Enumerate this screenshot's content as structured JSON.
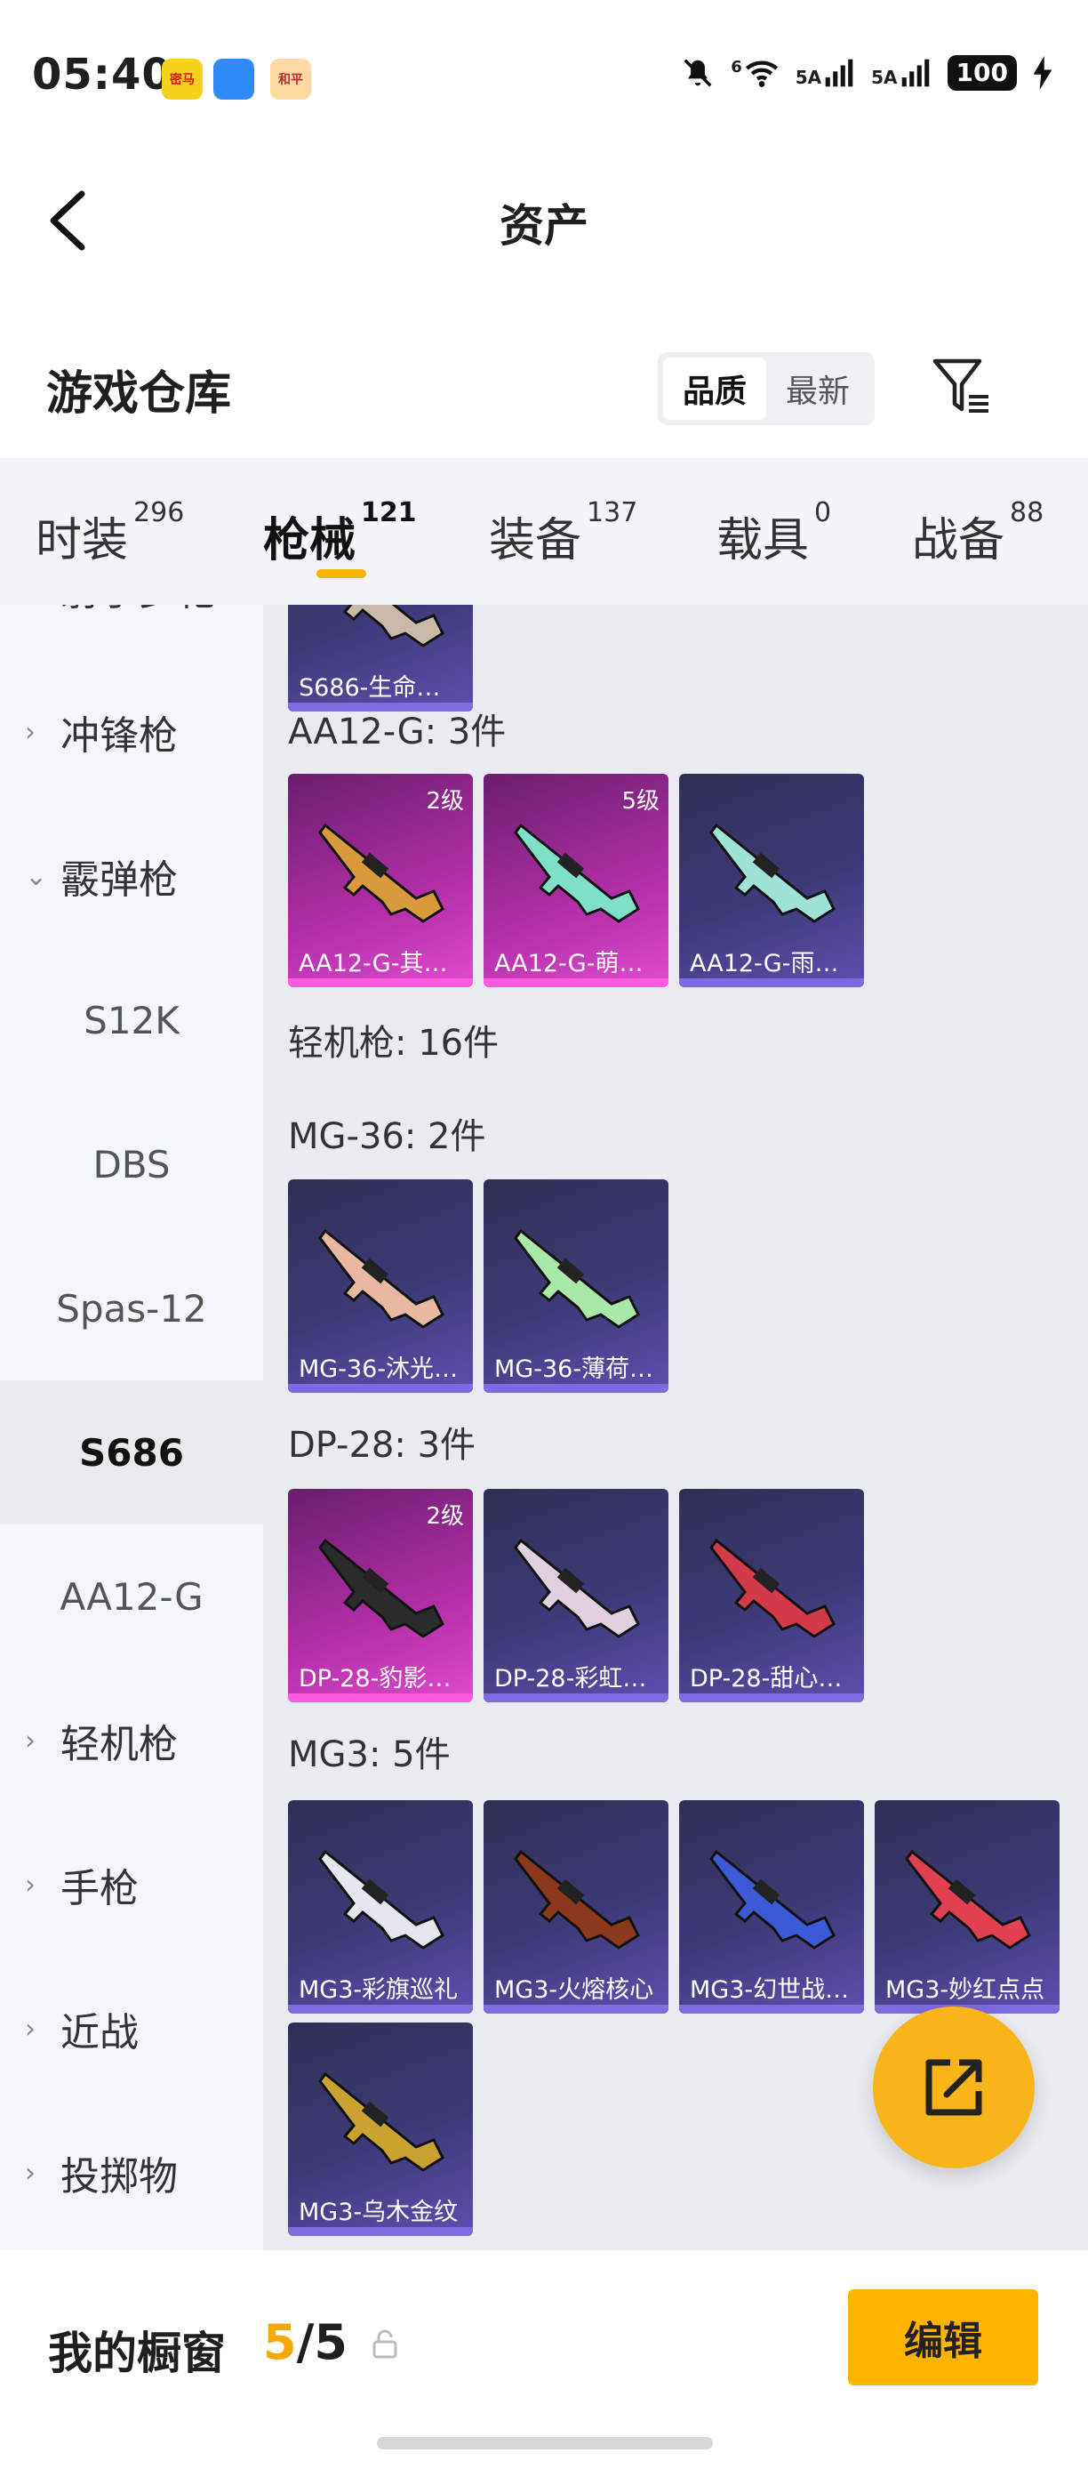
{
  "status": {
    "time": "05:40",
    "apps": [
      {
        "name": "app-icon-mima",
        "label": "密马",
        "bg": "#f7d21c",
        "fg": "#d11"
      },
      {
        "name": "app-icon-message",
        "label": "",
        "bg": "#2f8cf6",
        "fg": "#fff"
      },
      {
        "name": "app-icon-game",
        "label": "和平",
        "bg": "#ffd9a0",
        "fg": "#a33"
      }
    ],
    "signal1": "5A",
    "signal2": "5A",
    "wifi_label": "6",
    "battery": "100"
  },
  "header": {
    "title": "资产"
  },
  "warehouse": {
    "title": "游戏仓库",
    "sort": [
      "品质",
      "最新"
    ],
    "sort_active": 0
  },
  "tabs": [
    {
      "label": "时装",
      "count": "296"
    },
    {
      "label": "枪械",
      "count": "121"
    },
    {
      "label": "装备",
      "count": "137"
    },
    {
      "label": "载具",
      "count": "0"
    },
    {
      "label": "战备",
      "count": "88"
    }
  ],
  "tab_active": 1,
  "sidebar": [
    {
      "label": "射手步枪",
      "kind": "parent",
      "chev": "›"
    },
    {
      "label": "冲锋枪",
      "kind": "parent",
      "chev": "›"
    },
    {
      "label": "霰弹枪",
      "kind": "parent",
      "chev": "⌄"
    },
    {
      "label": "S12K",
      "kind": "child"
    },
    {
      "label": "DBS",
      "kind": "child"
    },
    {
      "label": "Spas-12",
      "kind": "child"
    },
    {
      "label": "S686",
      "kind": "child",
      "active": true
    },
    {
      "label": "AA12-G",
      "kind": "child"
    },
    {
      "label": "轻机枪",
      "kind": "parent",
      "chev": "›"
    },
    {
      "label": "手枪",
      "kind": "parent",
      "chev": "›"
    },
    {
      "label": "近战",
      "kind": "parent",
      "chev": "›"
    },
    {
      "label": "投掷物",
      "kind": "parent",
      "chev": "›"
    }
  ],
  "groups": [
    {
      "label": "",
      "items": [
        {
          "name": "S686-生命…",
          "style": "blue",
          "gun": "#c8b9a8",
          "lvl": ""
        }
      ]
    },
    {
      "label": "AA12-G: 3件",
      "items": [
        {
          "name": "AA12-G-其…",
          "style": "pink",
          "gun": "#d89a3a",
          "lvl": "2级"
        },
        {
          "name": "AA12-G-萌…",
          "style": "pink",
          "gun": "#7ee0c8",
          "lvl": "5级"
        },
        {
          "name": "AA12-G-雨…",
          "style": "blue",
          "gun": "#9fe3d8",
          "lvl": ""
        }
      ]
    },
    {
      "label": "轻机枪: 16件",
      "items": []
    },
    {
      "label": "MG-36: 2件",
      "items": [
        {
          "name": "MG-36-沐光…",
          "style": "blue",
          "gun": "#e8b8a0",
          "lvl": ""
        },
        {
          "name": "MG-36-薄荷…",
          "style": "blue",
          "gun": "#a8e8a8",
          "lvl": ""
        }
      ]
    },
    {
      "label": "DP-28: 3件",
      "items": [
        {
          "name": "DP-28-豹影…",
          "style": "pink",
          "gun": "#2b2b2b",
          "lvl": "2级"
        },
        {
          "name": "DP-28-彩虹…",
          "style": "blue",
          "gun": "#e0d0e0",
          "lvl": ""
        },
        {
          "name": "DP-28-甜心…",
          "style": "blue",
          "gun": "#d23a4a",
          "lvl": ""
        }
      ]
    },
    {
      "label": "MG3: 5件",
      "items": [
        {
          "name": "MG3-彩旗巡礼",
          "style": "blue",
          "gun": "#e6e6f0",
          "lvl": ""
        },
        {
          "name": "MG3-火熔核心",
          "style": "blue",
          "gun": "#8a3a1a",
          "lvl": ""
        },
        {
          "name": "MG3-幻世战…",
          "style": "blue",
          "gun": "#3a5ad8",
          "lvl": ""
        },
        {
          "name": "MG3-妙红点点",
          "style": "blue",
          "gun": "#e04050",
          "lvl": ""
        },
        {
          "name": "MG3-乌木金纹",
          "style": "blue",
          "gun": "#c9a230",
          "lvl": ""
        }
      ]
    }
  ],
  "bottom": {
    "label": "我的橱窗",
    "count_now": "5",
    "count_sep": "/",
    "count_max": "5",
    "edit": "编辑"
  }
}
